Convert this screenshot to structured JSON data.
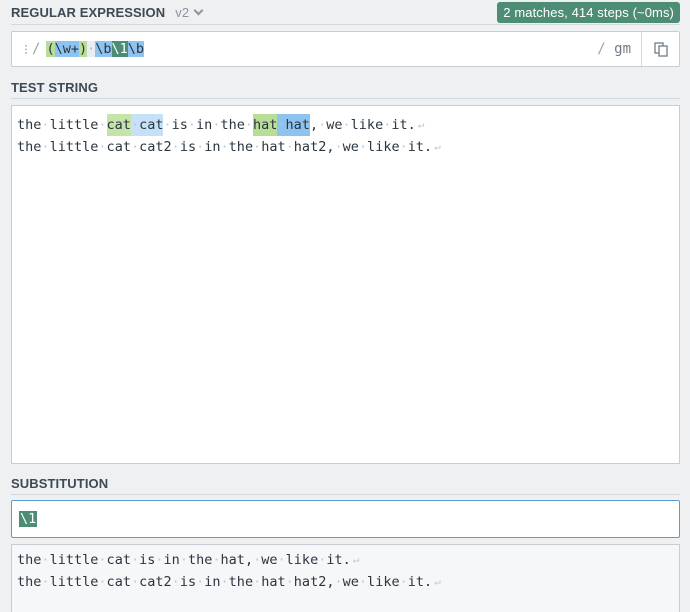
{
  "regex_section": {
    "title": "REGULAR EXPRESSION",
    "version": "v2",
    "match_info": "2 matches, 414 steps (~0ms)",
    "open_delim": "/",
    "tokens": {
      "open_paren": "(",
      "word": "\\w+",
      "close_paren": ")",
      "space": "·",
      "boundary1": "\\b",
      "backref": "\\1",
      "boundary2": "\\b"
    },
    "close_delim": "/",
    "flags": "gm"
  },
  "test_section": {
    "title": "TEST STRING",
    "line1": {
      "prefix": "the·little·",
      "match_a1": "cat",
      "match_a_space": "·",
      "match_a2": "cat",
      "middle": "·is·in·the·",
      "match_b1": "hat",
      "match_b_space": "·",
      "match_b2": "hat",
      "suffix": ",·we·like·it."
    },
    "line2": "the·little·cat·cat2·is·in·the·hat·hat2,·we·like·it.",
    "eol": "↵"
  },
  "substitution_section": {
    "title": "SUBSTITUTION",
    "value": "\\1",
    "result_line1": "the·little·cat·is·in·the·hat,·we·like·it.",
    "result_line2": "the·little·cat·cat2·is·in·the·hat·hat2,·we·like·it."
  },
  "colors": {
    "badge": "#4e8d75",
    "group_highlight": "#b8dd96",
    "escape_highlight": "#8fc3ef",
    "focus_border": "#5c9bd6"
  }
}
